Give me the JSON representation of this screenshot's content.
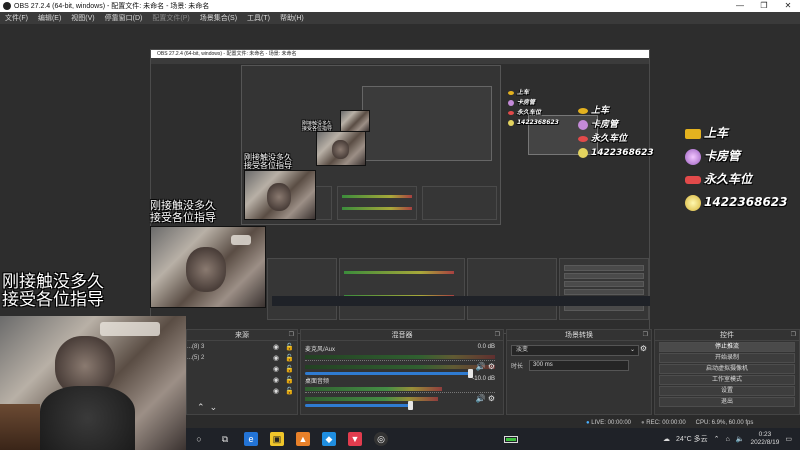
{
  "window": {
    "title": "OBS 27.2.4 (64-bit, windows) - 配置文件: 未命名 - 场景: 未命名",
    "controls": [
      "—",
      "❐",
      "✕"
    ]
  },
  "menu": [
    "文件(F)",
    "编辑(E)",
    "视图(V)",
    "停靠窗口(D)",
    "配置文件(P)",
    "场景集合(S)",
    "工具(T)",
    "帮助(H)"
  ],
  "preview": {
    "caption_lines": [
      "刚接触没多久",
      "接受各位指导"
    ],
    "overlay": {
      "line1": "上车",
      "line2": "卡房管",
      "line3": "永久车位",
      "line4": "1422368623"
    },
    "nested_title": "OBS 27.2.4 (64-bit, windows) - 配置文件: 未命名 - 场景: 未命名"
  },
  "sources": {
    "title": "来源",
    "items": [
      {
        "label": "...(8) 3"
      },
      {
        "label": "...(5) 2"
      },
      {
        "label": ""
      },
      {
        "label": ""
      },
      {
        "label": ""
      }
    ]
  },
  "mixer": {
    "title": "混音器",
    "channels": [
      {
        "name": "麦克风/Aux",
        "db": "0.0 dB"
      },
      {
        "name": "桌面音频",
        "db": "-10.0 dB"
      }
    ]
  },
  "transitions": {
    "title": "场景转换",
    "selected": "淡变",
    "duration_label": "时长",
    "duration_value": "300 ms"
  },
  "controls": {
    "title": "控件",
    "buttons": [
      "停止推流",
      "开始录制",
      "启动虚拟摄像机",
      "工作室模式",
      "设置",
      "退出"
    ]
  },
  "status": {
    "live": "LIVE: 00:00:00",
    "rec": "REC: 00:00:00",
    "cpu": "CPU: 6.9%, 60.00 fps"
  },
  "taskbar": {
    "weather": "24°C 多云",
    "time": "0:23",
    "date": "2022/8/19"
  },
  "colors": {
    "accent": "#2f7bd1",
    "meter_green": "#4aa44a",
    "meter_yellow": "#b0a63a",
    "meter_red": "#a84040"
  }
}
